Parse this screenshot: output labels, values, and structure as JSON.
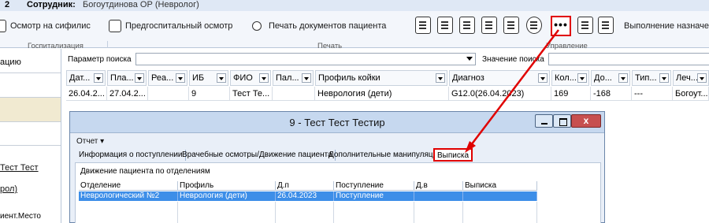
{
  "topbar": {
    "num": "2",
    "employee_label": "Сотрудник:",
    "employee_name": "Богоутдинова ОР (Невролог)"
  },
  "ribbon": {
    "btn_syphilis": "Осмотр на сифилис",
    "btn_prehosp": "Предгоспитальный осмотр",
    "btn_print_docs": "Печать документов пациента",
    "btn_more": "•••",
    "btn_exec": "Выполнение назначе",
    "groups": {
      "hosp": "Госпитализация",
      "print": "Печать",
      "manage": "Управление"
    }
  },
  "left_panel": {
    "item1": "ацию",
    "link1": "Тест Тест",
    "link2": "рол)",
    "item4": "иент.Место"
  },
  "search": {
    "param_label": "Параметр поиска",
    "value_label": "Значение поиска"
  },
  "grid": {
    "columns": [
      "Дат...",
      "Пла...",
      "Реа...",
      "ИБ",
      "ФИО",
      "Пал...",
      "Профиль койки",
      "Диагноз",
      "Кол...",
      "До...",
      "Тип...",
      "Леч..."
    ],
    "row": [
      "26.04.2...",
      "27.04.2...",
      "",
      "9",
      "Тест Те...",
      "",
      "Неврология (дети)",
      "G12.0(26.04.2023)",
      "169",
      "-168",
      "---",
      "Богоут..."
    ]
  },
  "dialog": {
    "title": "9 - Тест Тест Тестир",
    "close": "x",
    "menu_report": "Отчет ▾",
    "tabs": [
      "Информация о поступлении",
      "Врачебные осмотры/Движение пациента",
      "Дополнительные манипуляции",
      "Выписка"
    ],
    "section_title": "Движение пациента по отделениям",
    "columns": [
      "Отделение",
      "Профиль",
      "Д.п",
      "Поступление",
      "Д.в",
      "Выписка"
    ],
    "row": [
      "Неврологический №2",
      "Неврология (дети)",
      "26.04.2023",
      "Поступление",
      "",
      ""
    ]
  },
  "colors": {
    "annotation": "#e00000",
    "selection": "#3d8ee8",
    "title_bar": "#c6d8ef"
  }
}
